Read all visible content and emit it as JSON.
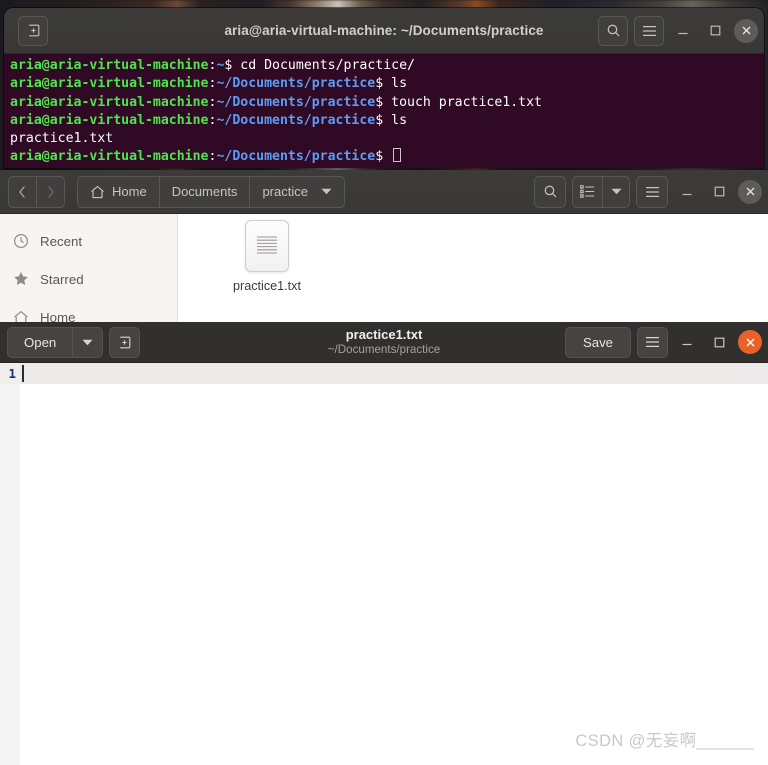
{
  "terminal": {
    "title": "aria@aria-virtual-machine: ~/Documents/practice",
    "new_tab_icon": "new-tab-icon",
    "search_icon": "search-icon",
    "menu_icon": "hamburger-menu-icon",
    "minimize_icon": "minimize-icon",
    "maximize_icon": "maximize-icon",
    "close_icon": "close-icon",
    "background_color": "#300a24",
    "user_color": "#4ee44e",
    "path_color": "#5c9cf5",
    "lines": [
      {
        "user": "aria@aria-virtual-machine",
        "colon": ":",
        "path": "~",
        "dollar": "$ ",
        "command": "cd Documents/practice/"
      },
      {
        "user": "aria@aria-virtual-machine",
        "colon": ":",
        "path": "~/Documents/practice",
        "dollar": "$ ",
        "command": "ls"
      },
      {
        "user": "aria@aria-virtual-machine",
        "colon": ":",
        "path": "~/Documents/practice",
        "dollar": "$ ",
        "command": "touch practice1.txt"
      },
      {
        "user": "aria@aria-virtual-machine",
        "colon": ":",
        "path": "~/Documents/practice",
        "dollar": "$ ",
        "command": "ls"
      },
      {
        "output": "practice1.txt"
      },
      {
        "user": "aria@aria-virtual-machine",
        "colon": ":",
        "path": "~/Documents/practice",
        "dollar": "$ ",
        "command": "",
        "cursor": true
      }
    ]
  },
  "file_manager": {
    "back_icon": "chevron-left-icon",
    "forward_icon": "chevron-right-icon",
    "breadcrumbs": [
      {
        "label": "Home",
        "icon": "home-icon"
      },
      {
        "label": "Documents"
      },
      {
        "label": "practice",
        "icon": "chevron-down-icon"
      }
    ],
    "search_icon": "search-icon",
    "view_list_icon": "list-view-icon",
    "view_dropdown_icon": "chevron-down-icon",
    "menu_icon": "hamburger-menu-icon",
    "minimize_icon": "minimize-icon",
    "maximize_icon": "maximize-icon",
    "close_icon": "close-icon",
    "sidebar": [
      {
        "label": "Recent",
        "icon": "clock-icon"
      },
      {
        "label": "Starred",
        "icon": "star-icon"
      },
      {
        "label": "Home",
        "icon": "home-icon"
      }
    ],
    "files": [
      {
        "name": "practice1.txt",
        "icon": "text-file-icon"
      }
    ]
  },
  "editor": {
    "open_label": "Open",
    "open_dropdown_icon": "chevron-down-icon",
    "new_tab_icon": "new-tab-icon",
    "title": "practice1.txt",
    "subtitle": "~/Documents/practice",
    "save_label": "Save",
    "menu_icon": "hamburger-menu-icon",
    "minimize_icon": "minimize-icon",
    "maximize_icon": "maximize-icon",
    "close_icon": "close-icon",
    "close_color": "#e8622a",
    "line_numbers": [
      "1"
    ],
    "content": ""
  },
  "watermark": {
    "text": "CSDN @无妄啊______"
  }
}
